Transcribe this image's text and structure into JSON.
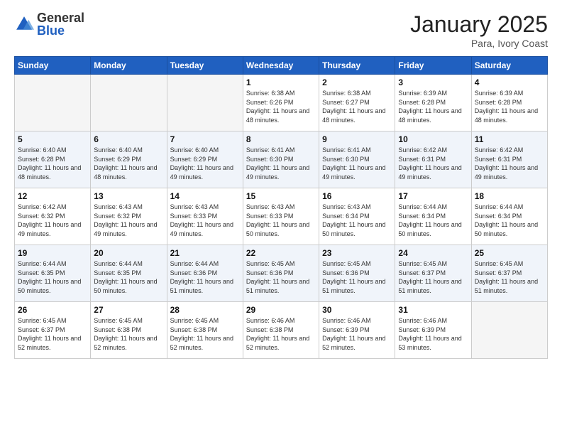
{
  "logo": {
    "general": "General",
    "blue": "Blue"
  },
  "title": "January 2025",
  "subtitle": "Para, Ivory Coast",
  "days_header": [
    "Sunday",
    "Monday",
    "Tuesday",
    "Wednesday",
    "Thursday",
    "Friday",
    "Saturday"
  ],
  "weeks": [
    [
      {
        "num": "",
        "sunrise": "",
        "sunset": "",
        "daylight": ""
      },
      {
        "num": "",
        "sunrise": "",
        "sunset": "",
        "daylight": ""
      },
      {
        "num": "",
        "sunrise": "",
        "sunset": "",
        "daylight": ""
      },
      {
        "num": "1",
        "sunrise": "6:38 AM",
        "sunset": "6:26 PM",
        "daylight": "11 hours and 48 minutes."
      },
      {
        "num": "2",
        "sunrise": "6:38 AM",
        "sunset": "6:27 PM",
        "daylight": "11 hours and 48 minutes."
      },
      {
        "num": "3",
        "sunrise": "6:39 AM",
        "sunset": "6:28 PM",
        "daylight": "11 hours and 48 minutes."
      },
      {
        "num": "4",
        "sunrise": "6:39 AM",
        "sunset": "6:28 PM",
        "daylight": "11 hours and 48 minutes."
      }
    ],
    [
      {
        "num": "5",
        "sunrise": "6:40 AM",
        "sunset": "6:28 PM",
        "daylight": "11 hours and 48 minutes."
      },
      {
        "num": "6",
        "sunrise": "6:40 AM",
        "sunset": "6:29 PM",
        "daylight": "11 hours and 48 minutes."
      },
      {
        "num": "7",
        "sunrise": "6:40 AM",
        "sunset": "6:29 PM",
        "daylight": "11 hours and 49 minutes."
      },
      {
        "num": "8",
        "sunrise": "6:41 AM",
        "sunset": "6:30 PM",
        "daylight": "11 hours and 49 minutes."
      },
      {
        "num": "9",
        "sunrise": "6:41 AM",
        "sunset": "6:30 PM",
        "daylight": "11 hours and 49 minutes."
      },
      {
        "num": "10",
        "sunrise": "6:42 AM",
        "sunset": "6:31 PM",
        "daylight": "11 hours and 49 minutes."
      },
      {
        "num": "11",
        "sunrise": "6:42 AM",
        "sunset": "6:31 PM",
        "daylight": "11 hours and 49 minutes."
      }
    ],
    [
      {
        "num": "12",
        "sunrise": "6:42 AM",
        "sunset": "6:32 PM",
        "daylight": "11 hours and 49 minutes."
      },
      {
        "num": "13",
        "sunrise": "6:43 AM",
        "sunset": "6:32 PM",
        "daylight": "11 hours and 49 minutes."
      },
      {
        "num": "14",
        "sunrise": "6:43 AM",
        "sunset": "6:33 PM",
        "daylight": "11 hours and 49 minutes."
      },
      {
        "num": "15",
        "sunrise": "6:43 AM",
        "sunset": "6:33 PM",
        "daylight": "11 hours and 50 minutes."
      },
      {
        "num": "16",
        "sunrise": "6:43 AM",
        "sunset": "6:34 PM",
        "daylight": "11 hours and 50 minutes."
      },
      {
        "num": "17",
        "sunrise": "6:44 AM",
        "sunset": "6:34 PM",
        "daylight": "11 hours and 50 minutes."
      },
      {
        "num": "18",
        "sunrise": "6:44 AM",
        "sunset": "6:34 PM",
        "daylight": "11 hours and 50 minutes."
      }
    ],
    [
      {
        "num": "19",
        "sunrise": "6:44 AM",
        "sunset": "6:35 PM",
        "daylight": "11 hours and 50 minutes."
      },
      {
        "num": "20",
        "sunrise": "6:44 AM",
        "sunset": "6:35 PM",
        "daylight": "11 hours and 50 minutes."
      },
      {
        "num": "21",
        "sunrise": "6:44 AM",
        "sunset": "6:36 PM",
        "daylight": "11 hours and 51 minutes."
      },
      {
        "num": "22",
        "sunrise": "6:45 AM",
        "sunset": "6:36 PM",
        "daylight": "11 hours and 51 minutes."
      },
      {
        "num": "23",
        "sunrise": "6:45 AM",
        "sunset": "6:36 PM",
        "daylight": "11 hours and 51 minutes."
      },
      {
        "num": "24",
        "sunrise": "6:45 AM",
        "sunset": "6:37 PM",
        "daylight": "11 hours and 51 minutes."
      },
      {
        "num": "25",
        "sunrise": "6:45 AM",
        "sunset": "6:37 PM",
        "daylight": "11 hours and 51 minutes."
      }
    ],
    [
      {
        "num": "26",
        "sunrise": "6:45 AM",
        "sunset": "6:37 PM",
        "daylight": "11 hours and 52 minutes."
      },
      {
        "num": "27",
        "sunrise": "6:45 AM",
        "sunset": "6:38 PM",
        "daylight": "11 hours and 52 minutes."
      },
      {
        "num": "28",
        "sunrise": "6:45 AM",
        "sunset": "6:38 PM",
        "daylight": "11 hours and 52 minutes."
      },
      {
        "num": "29",
        "sunrise": "6:46 AM",
        "sunset": "6:38 PM",
        "daylight": "11 hours and 52 minutes."
      },
      {
        "num": "30",
        "sunrise": "6:46 AM",
        "sunset": "6:39 PM",
        "daylight": "11 hours and 52 minutes."
      },
      {
        "num": "31",
        "sunrise": "6:46 AM",
        "sunset": "6:39 PM",
        "daylight": "11 hours and 53 minutes."
      },
      {
        "num": "",
        "sunrise": "",
        "sunset": "",
        "daylight": ""
      }
    ]
  ]
}
